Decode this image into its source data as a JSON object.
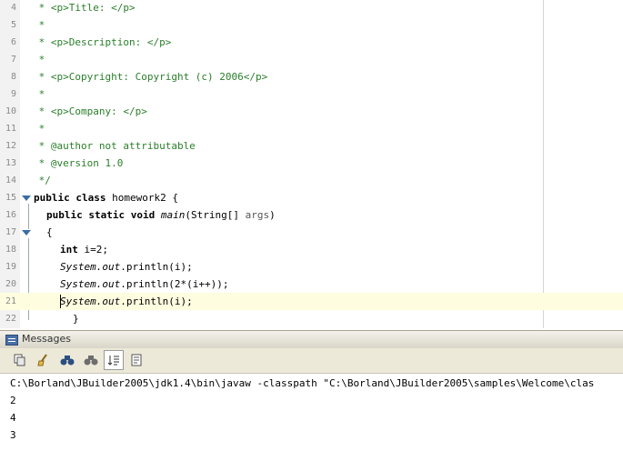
{
  "editor": {
    "lines": [
      {
        "n": "4",
        "text": " * <p>Title: </p>"
      },
      {
        "n": "5",
        "text": " *"
      },
      {
        "n": "6",
        "text": " * <p>Description: </p>"
      },
      {
        "n": "7",
        "text": " *"
      },
      {
        "n": "8",
        "text": " * <p>Copyright: Copyright (c) 2006</p>"
      },
      {
        "n": "9",
        "text": " *"
      },
      {
        "n": "10",
        "text": " * <p>Company: </p>"
      },
      {
        "n": "11",
        "text": " *"
      },
      {
        "n": "12",
        "text": " * @author not attributable"
      },
      {
        "n": "13",
        "text": " * @version 1.0"
      },
      {
        "n": "14",
        "text": " */"
      },
      {
        "n": "15",
        "kw": "public class ",
        "text": "homework2 {"
      },
      {
        "n": "16",
        "kw": "public static void ",
        "it": "main",
        "text": "(String[] ",
        "param": "args",
        ")": ")"
      },
      {
        "n": "17",
        "text": "{"
      },
      {
        "n": "18",
        "kw": "int ",
        "text": "i=2;"
      },
      {
        "n": "19",
        "it": "System.out",
        "text": ".println(i);"
      },
      {
        "n": "20",
        "it": "System.out",
        "text": ".println(2*(i++));"
      },
      {
        "n": "21",
        "it": "System.out",
        "text": ".println(i);"
      },
      {
        "n": "22",
        "text": "}"
      }
    ]
  },
  "messages": {
    "title": "Messages",
    "toolbar": [
      "copy-icon",
      "clear-icon",
      "find-icon",
      "find-next-icon",
      "wrap-icon",
      "print-icon"
    ],
    "output": [
      "C:\\Borland\\JBuilder2005\\jdk1.4\\bin\\javaw -classpath \"C:\\Borland\\JBuilder2005\\samples\\Welcome\\clas",
      "2",
      "4",
      "3"
    ]
  },
  "colors": {
    "comment": "#2a7e2a",
    "current_line": "#fffde0",
    "gutter": "#f2f2f2",
    "toolbar": "#ece9d8"
  }
}
